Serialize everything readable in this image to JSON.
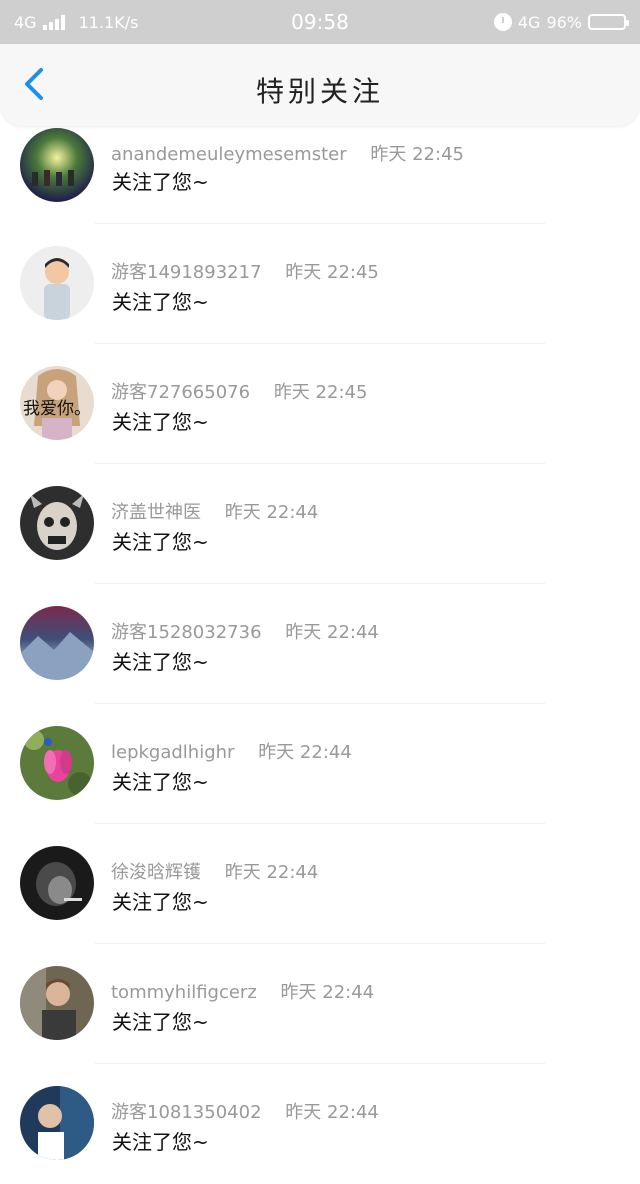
{
  "status_bar": {
    "network_left": "4G",
    "speed": "11.1K/s",
    "time": "09:58",
    "network_right": "4G",
    "battery": "96%"
  },
  "header": {
    "title": "特别关注"
  },
  "items": [
    {
      "name": "anandemeuleymesemster",
      "time": "昨天 22:45",
      "message": "关注了您~",
      "avatar_text": ""
    },
    {
      "name": "游客1491893217",
      "time": "昨天 22:45",
      "message": "关注了您~",
      "avatar_text": ""
    },
    {
      "name": "游客727665076",
      "time": "昨天 22:45",
      "message": "关注了您~",
      "avatar_text": "我爱你。"
    },
    {
      "name": "济盖世神医",
      "time": "昨天 22:44",
      "message": "关注了您~",
      "avatar_text": ""
    },
    {
      "name": "游客1528032736",
      "time": "昨天 22:44",
      "message": "关注了您~",
      "avatar_text": ""
    },
    {
      "name": "lepkgadlhighr",
      "time": "昨天 22:44",
      "message": "关注了您~",
      "avatar_text": ""
    },
    {
      "name": "徐浚晗辉镬",
      "time": "昨天 22:44",
      "message": "关注了您~",
      "avatar_text": ""
    },
    {
      "name": "tommyhilfigcerz",
      "time": "昨天 22:44",
      "message": "关注了您~",
      "avatar_text": ""
    },
    {
      "name": "游客1081350402",
      "time": "昨天 22:44",
      "message": "关注了您~",
      "avatar_text": ""
    }
  ],
  "colors": {
    "status_bar_bg": "#cfcfcf",
    "header_bg": "#f7f7f7",
    "back_arrow": "#1e90e6",
    "meta_text": "#999999",
    "message_text": "#111111"
  }
}
